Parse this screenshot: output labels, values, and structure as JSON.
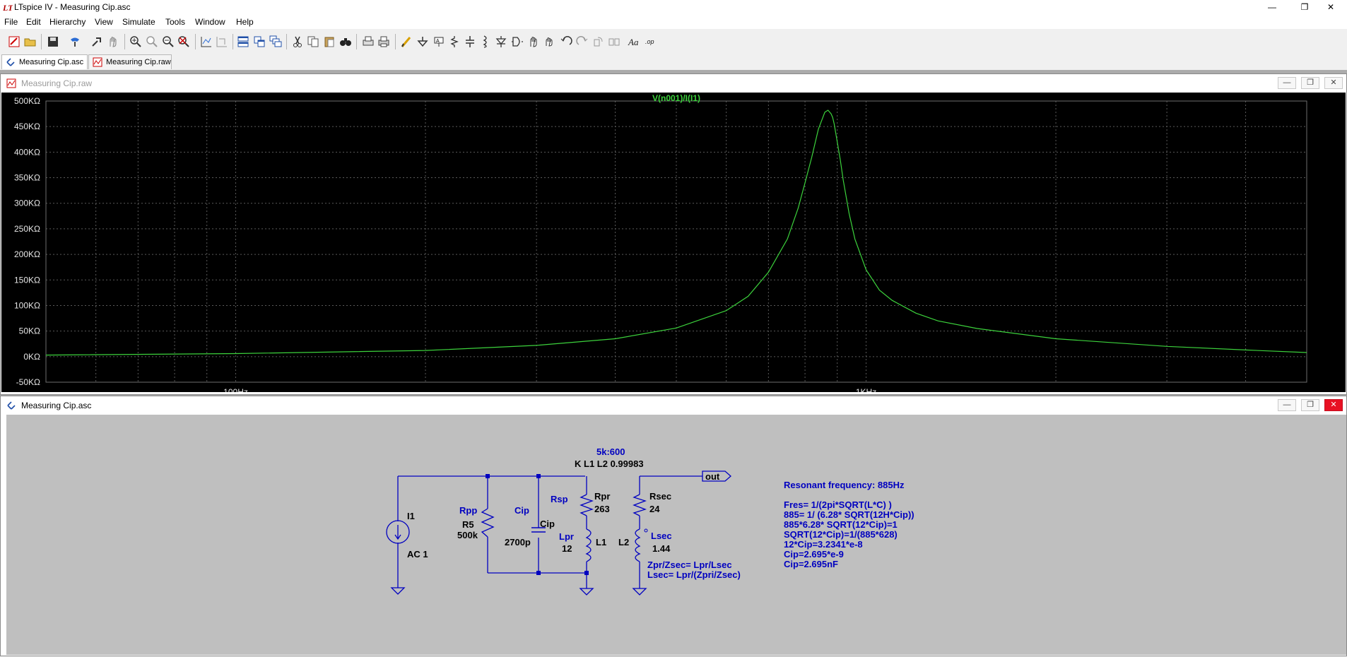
{
  "window": {
    "title": "LTspice IV - Measuring Cip.asc",
    "min_glyph": "—",
    "max_glyph": "❐",
    "close_glyph": "✕"
  },
  "menu": [
    "File",
    "Edit",
    "Hierarchy",
    "View",
    "Simulate",
    "Tools",
    "Window",
    "Help"
  ],
  "toolbar_icons": [
    "new-schematic-icon",
    "open-icon",
    "save-icon",
    "control-panel-icon",
    "run-icon",
    "halt-icon",
    "zoom-in-icon",
    "zoom-back-icon",
    "zoom-out-icon",
    "zoom-fit-icon",
    "autorange-icon",
    "dc-op-icon",
    "tile-horizontal-icon",
    "tile-vertical-icon",
    "cascade-icon",
    "cut-icon",
    "copy-icon",
    "paste-icon",
    "find-icon",
    "print-setup-icon",
    "print-icon",
    "wire-icon",
    "ground-icon",
    "label-icon",
    "resistor-icon",
    "capacitor-icon",
    "inductor-icon",
    "diode-icon",
    "component-icon",
    "move-icon",
    "drag-icon",
    "undo-icon",
    "redo-icon",
    "rotate-icon",
    "mirror-icon",
    "text-icon",
    "spice-directive-icon"
  ],
  "tabs": [
    {
      "label": "Measuring Cip.asc",
      "active": true
    },
    {
      "label": "Measuring Cip.raw",
      "active": false
    }
  ],
  "waveform_window": {
    "title": "Measuring Cip.raw",
    "trace_label": "V(n001)/I(I1)",
    "trace_color": "#3cd23c",
    "chart_data": {
      "type": "line",
      "title": "V(n001)/I(I1)",
      "xscale": "log",
      "xlim": [
        50,
        5000
      ],
      "ylim": [
        -50,
        500
      ],
      "grid": true,
      "y_ticks": [
        "500KΩ",
        "450KΩ",
        "400KΩ",
        "350KΩ",
        "300KΩ",
        "250KΩ",
        "200KΩ",
        "150KΩ",
        "100KΩ",
        "50KΩ",
        "0KΩ",
        "-50KΩ"
      ],
      "x_ticks": [
        "100Hz",
        "1KHz"
      ],
      "series": [
        {
          "x": [
            50,
            100,
            200,
            300,
            400,
            500,
            600,
            650,
            700,
            750,
            780,
            800,
            820,
            840,
            860,
            870,
            880,
            885,
            890,
            900,
            910,
            920,
            940,
            960,
            1000,
            1050,
            1100,
            1200,
            1300,
            1500,
            2000,
            3000,
            4000,
            5000
          ],
          "y": [
            3,
            6,
            12,
            22,
            35,
            56,
            90,
            118,
            165,
            230,
            290,
            340,
            390,
            445,
            478,
            482,
            475,
            468,
            455,
            420,
            385,
            345,
            280,
            230,
            170,
            130,
            110,
            85,
            70,
            55,
            35,
            20,
            13,
            8
          ]
        }
      ]
    }
  },
  "schematic_window": {
    "title": "Measuring Cip.asc",
    "directive_ratio": "5k:600",
    "directive_k": "K L1 L2 0.99983",
    "components": {
      "i1_name": "I1",
      "i1_value": "AC 1",
      "rpp_label": "Rpp",
      "r5_name": "R5",
      "r5_value": "500k",
      "cip_label": "Cip",
      "cip_name": "Cip",
      "cip_value": "2700p",
      "rsp_label": "Rsp",
      "rpr_name": "Rpr",
      "rpr_value": "263",
      "lpr_label": "Lpr",
      "lpr_value": "12",
      "l1_name": "L1",
      "l2_name": "L2",
      "rsec_name": "Rsec",
      "rsec_value": "24",
      "lsec_name": "Lsec",
      "lsec_value": "1.44",
      "out_label": "out"
    },
    "notes_left": [
      "Zpr/Zsec= Lpr/Lsec",
      "Lsec= Lpr/(Zpri/Zsec)"
    ],
    "notes_right": [
      "Resonant frequency: 885Hz",
      "",
      "Fres= 1/(2pi*SQRT(L*C) )",
      "885= 1/ (6.28* SQRT(12H*Cip))",
      "885*6.28* SQRT(12*Cip)=1",
      "SQRT(12*Cip)=1/(885*628)",
      "12*Cip=3.2341*e-8",
      "Cip=2.695*e-9",
      "Cip=2.695nF"
    ],
    "wire_color": "#0000c0",
    "label_blue": "#0000c0"
  }
}
